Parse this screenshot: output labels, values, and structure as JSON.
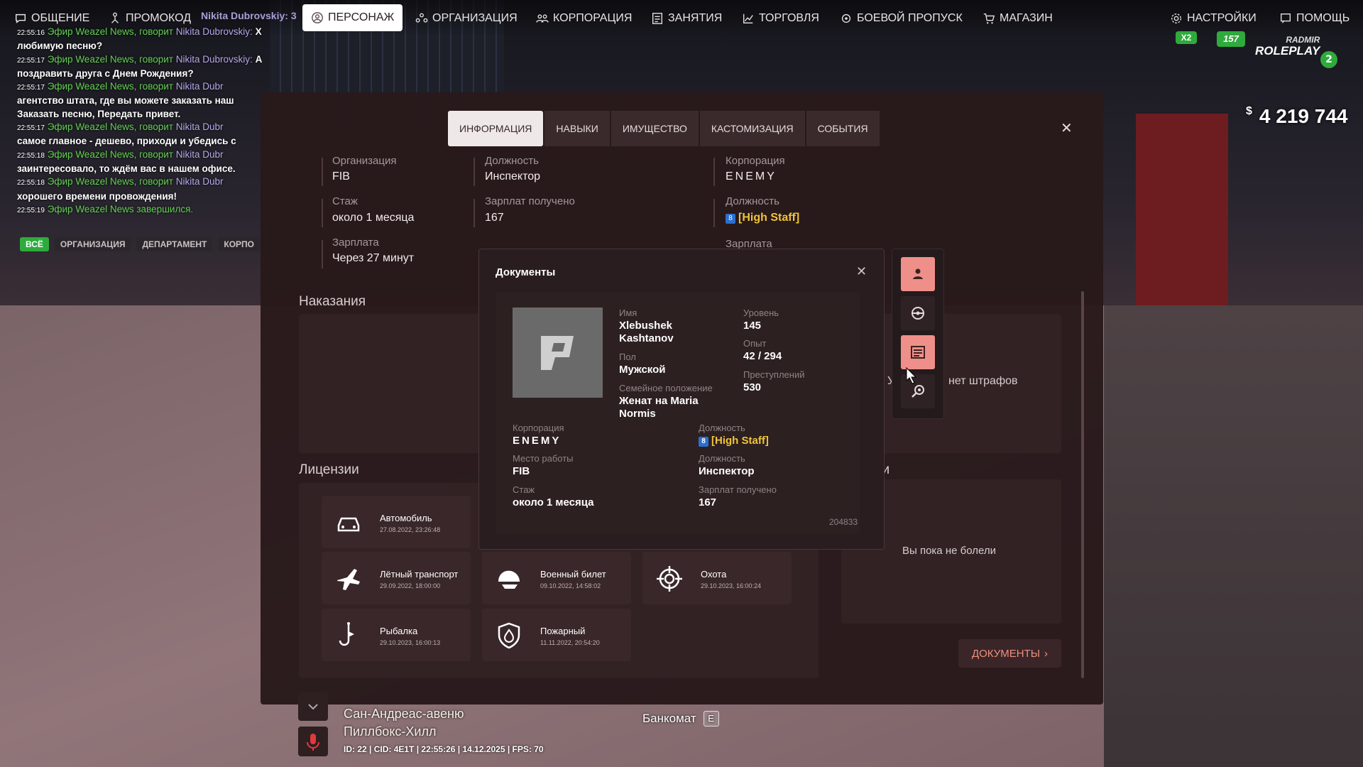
{
  "nav": {
    "items": [
      "ОБЩЕНИЕ",
      "ПРОМОКОД",
      "ПЕРСОНАЖ",
      "ОРГАНИЗАЦИЯ",
      "КОРПОРАЦИЯ",
      "ЗАНЯТИЯ",
      "ТОРГОВЛЯ",
      "БОЕВОЙ ПРОПУСК",
      "МАГАЗИН",
      "НАСТРОЙКИ",
      "ПОМОЩЬ"
    ],
    "active": "ПЕРСОНАЖ",
    "overlay_name": "Nikita Dubrovskiy: 3"
  },
  "chat": {
    "lines": [
      {
        "time": "22:55:16",
        "channel": "Эфир Weazel News, говорит",
        "name": "Nikita Dubrovskiy:",
        "text": "Хотите послушать свою"
      },
      {
        "time": "",
        "channel": "",
        "name": "",
        "text": "любимую песню?"
      },
      {
        "time": "22:55:17",
        "channel": "Эфир Weazel News, говорит",
        "name": "Nikita Dubrovskiy:",
        "text": "А может хотите"
      },
      {
        "time": "",
        "channel": "",
        "name": "",
        "text": "поздравить друга с Днем Рождения?"
      },
      {
        "time": "22:55:17",
        "channel": "Эфир Weazel News, говорит",
        "name": "Nikita Dubr",
        "text": ""
      },
      {
        "time": "",
        "channel": "",
        "name": "",
        "text": "агентство штата, где вы можете заказать наш"
      },
      {
        "time": "",
        "channel": "",
        "name": "",
        "text": "Заказать песню, Передать привет."
      },
      {
        "time": "22:55:17",
        "channel": "Эфир Weazel News, говорит",
        "name": "Nikita Dubr",
        "text": ""
      },
      {
        "time": "",
        "channel": "",
        "name": "",
        "text": "самое главное - дешево, приходи и убедись с"
      },
      {
        "time": "22:55:18",
        "channel": "Эфир Weazel News, говорит",
        "name": "Nikita Dubr",
        "text": ""
      },
      {
        "time": "",
        "channel": "",
        "name": "",
        "text": "заинтересовало, то ждём вас в нашем офисе."
      },
      {
        "time": "22:55:18",
        "channel": "Эфир Weazel News, говорит",
        "name": "Nikita Dubr",
        "text": ""
      },
      {
        "time": "",
        "channel": "",
        "name": "",
        "text": "хорошего времени провождения!"
      },
      {
        "time": "22:55:19",
        "channel": "Эфир Weazel News завершился.",
        "name": "",
        "text": ""
      }
    ],
    "tabs": [
      "ВСЁ",
      "ОРГАНИЗАЦИЯ",
      "ДЕПАРТАМЕНТ",
      "КОРПО"
    ]
  },
  "hud": {
    "money_currency": "$",
    "money": "4 219 744",
    "x2": "X2",
    "online": "157",
    "brand_top": "RADMIR",
    "brand_bottom": "ROLEPLAY",
    "server": "2",
    "street": "Сан-Андреас-авеню",
    "district": "Пиллбокс-Хилл",
    "status_line": "ID: 22 | CID: 4E1T | 22:55:26 | 14.12.2025 | FPS: 70",
    "atm_label": "Банкомат",
    "atm_key": "E"
  },
  "tabs": [
    "ИНФОРМАЦИЯ",
    "НАВЫКИ",
    "ИМУЩЕСТВО",
    "КАСТОМИЗАЦИЯ",
    "СОБЫТИЯ"
  ],
  "info": {
    "organization": {
      "label": "Организация",
      "value": "FIB"
    },
    "position": {
      "label": "Должность",
      "value": "Инспектор"
    },
    "tenure": {
      "label": "Стаж",
      "value": "около 1 месяца"
    },
    "salary_received": {
      "label": "Зарплат получено",
      "value": "167"
    },
    "salary": {
      "label": "Зарплата",
      "value": "Через 27 минут"
    },
    "corporation": {
      "label": "Корпорация",
      "value": "ENEMY"
    },
    "corp_position": {
      "label": "Должность",
      "badge": "8",
      "value": "[High Staff]"
    },
    "corp_salary": {
      "label": "Зарплата"
    }
  },
  "sections": {
    "punishments": "Наказания",
    "no_fines": "нет штрафов",
    "no_fines_prefix": "У",
    "licenses": "Лицензии",
    "illness_partial": "ни",
    "illness_text": "Вы пока не болели",
    "docs_button": "ДОКУМЕНТЫ"
  },
  "licenses": [
    {
      "icon": "car-icon",
      "title": "Автомобиль",
      "date": "27.08.2022, 23:26:48"
    },
    {
      "icon": "plane-icon",
      "title": "Лётный транспорт",
      "date": "29.09.2022, 18:00:00"
    },
    {
      "icon": "helmet-icon",
      "title": "Военный билет",
      "date": "09.10.2022, 14:58:02"
    },
    {
      "icon": "crosshair-icon",
      "title": "Охота",
      "date": "29.10.2023, 16:00:24"
    },
    {
      "icon": "fishing-icon",
      "title": "Рыбалка",
      "date": "29.10.2023, 16:00:13"
    },
    {
      "icon": "fire-shield-icon",
      "title": "Пожарный",
      "date": "11.11.2022, 20:54:20"
    }
  ],
  "documents": {
    "title": "Документы",
    "name_label": "Имя",
    "name": "Xlebushek Kashtanov",
    "name_line1": "Xlebushek",
    "name_line2": "Kashtanov",
    "gender_label": "Пол",
    "gender": "Мужской",
    "family_label": "Семейное положение",
    "family_line1": "Женат на Maria",
    "family_line2": "Normis",
    "level_label": "Уровень",
    "level": "145",
    "exp_label": "Опыт",
    "exp": "42 / 294",
    "crimes_label": "Преступлений",
    "crimes": "530",
    "corp_label": "Корпорация",
    "corp": "ENEMY",
    "corp_pos_label": "Должность",
    "corp_pos_badge": "8",
    "corp_pos": "[High Staff]",
    "work_label": "Место работы",
    "work": "FIB",
    "pos_label": "Должность",
    "pos": "Инспектор",
    "tenure_label": "Стаж",
    "tenure": "около 1 месяца",
    "salary_label": "Зарплат получено",
    "salary": "167",
    "number": "204833"
  },
  "sidetools": [
    {
      "icon": "person-icon",
      "active": true
    },
    {
      "icon": "steering-wheel-icon",
      "active": false
    },
    {
      "icon": "license-card-icon",
      "active": true
    },
    {
      "icon": "magnifier-gear-icon",
      "active": false
    }
  ],
  "colors": {
    "panel": "#28191b",
    "accent_pink": "#ef8f89",
    "gold": "#f0c43a",
    "chat_green": "#62d152",
    "chat_name": "#b7a7ea",
    "docs_button": "#ee8f7f"
  }
}
